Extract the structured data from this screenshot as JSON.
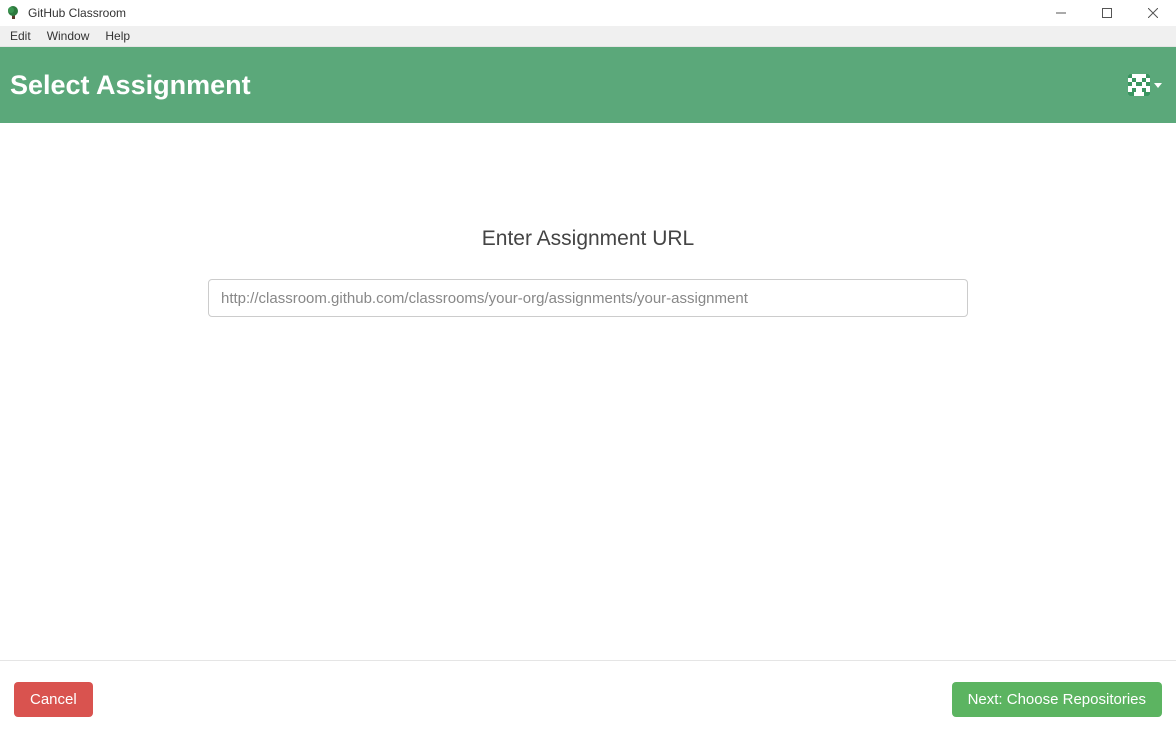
{
  "window": {
    "title": "GitHub Classroom"
  },
  "menubar": {
    "items": [
      "Edit",
      "Window",
      "Help"
    ]
  },
  "banner": {
    "title": "Select Assignment"
  },
  "content": {
    "heading": "Enter Assignment URL",
    "url_placeholder": "http://classroom.github.com/classrooms/your-org/assignments/your-assignment",
    "url_value": ""
  },
  "footer": {
    "cancel_label": "Cancel",
    "next_label": "Next: Choose Repositories"
  }
}
